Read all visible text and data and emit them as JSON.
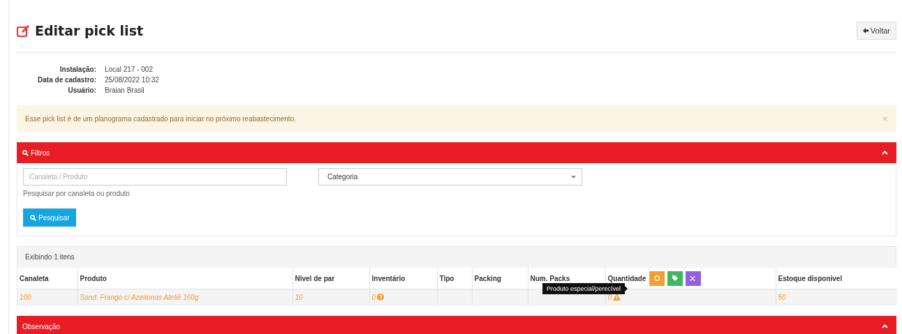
{
  "page": {
    "title": "Editar pick list",
    "back_button": "Voltar"
  },
  "info": [
    {
      "label": "Instalação:",
      "value": "Local 217 - 002"
    },
    {
      "label": "Data de cadastro:",
      "value": "25/08/2022 10:32"
    },
    {
      "label": "Usuário:",
      "value": "Braian Brasil"
    }
  ],
  "alert": {
    "text": "Esse pick list é de um planograma cadastrado para iniciar no próximo reabastecimento.",
    "close": "×"
  },
  "filters": {
    "title": "Filtros",
    "expanded": true,
    "search": {
      "placeholder": "Canaleta / Produto",
      "help": "Pesquisar por canaleta ou produto"
    },
    "category": {
      "value": "Categoria"
    },
    "button": "Pesquisar"
  },
  "items": {
    "count_text": "Exibindo 1 itens",
    "columns": [
      "Canaleta",
      "Produto",
      "Nivel de par",
      "Inventário",
      "Tipo",
      "Packing",
      "Num. Packs",
      "Quantidade",
      "Estoque disponivel"
    ],
    "rows": [
      {
        "cells": [
          {
            "text": "100"
          },
          {
            "text": "Sand. Frango c/ Azeitonas Ateliê 160g"
          },
          {
            "text": "10"
          },
          {
            "text": "0",
            "kind": "help"
          },
          {},
          {},
          {},
          {
            "text": "0",
            "kind": "warning"
          },
          {
            "text": "50"
          }
        ]
      }
    ],
    "tooltip": "Produto especial/perecível"
  },
  "observation": {
    "title": "Observação",
    "expanded": true
  }
}
